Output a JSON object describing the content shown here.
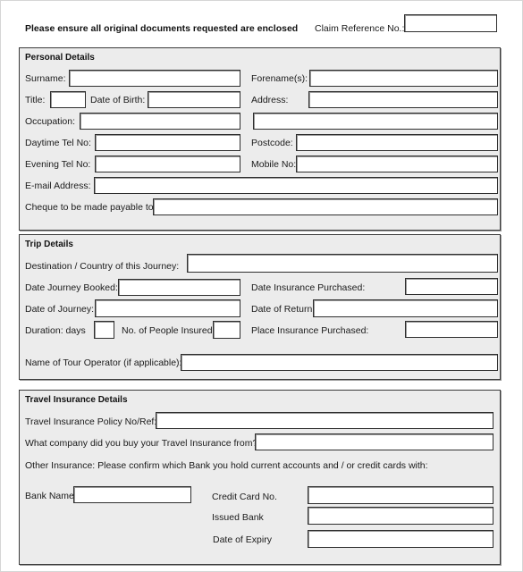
{
  "header": {
    "notice": "Please ensure all original documents requested are enclosed",
    "claim_ref_label": "Claim Reference No.:",
    "claim_ref_value": ""
  },
  "personal": {
    "title": "Personal Details",
    "fields": {
      "surname": {
        "label": "Surname:",
        "value": ""
      },
      "forenames": {
        "label": "Forename(s):",
        "value": ""
      },
      "title": {
        "label": "Title:",
        "value": ""
      },
      "dob": {
        "label": "Date of Birth:",
        "value": ""
      },
      "address": {
        "label": "Address:",
        "value": ""
      },
      "address2": {
        "value": ""
      },
      "occupation": {
        "label": "Occupation:",
        "value": ""
      },
      "day_tel": {
        "label": "Daytime Tel No:",
        "value": ""
      },
      "postcode": {
        "label": "Postcode:",
        "value": ""
      },
      "eve_tel": {
        "label": "Evening Tel No:",
        "value": ""
      },
      "mobile": {
        "label": "Mobile No:",
        "value": ""
      },
      "email": {
        "label": "E-mail Address:",
        "value": ""
      },
      "cheque": {
        "label": "Cheque to be made payable to:",
        "value": ""
      }
    }
  },
  "trip": {
    "title": "Trip Details",
    "fields": {
      "destination": {
        "label": "Destination / Country of this Journey:",
        "value": ""
      },
      "date_booked": {
        "label": "Date Journey Booked:",
        "value": ""
      },
      "date_ins_purchased": {
        "label": "Date Insurance Purchased:",
        "value": ""
      },
      "date_journey": {
        "label": "Date of Journey:",
        "value": ""
      },
      "date_return": {
        "label": "Date of Return:",
        "value": ""
      },
      "duration": {
        "label": "Duration:  days",
        "value": ""
      },
      "people": {
        "label": "No. of People Insured:",
        "value": ""
      },
      "place_ins": {
        "label": "Place Insurance Purchased:",
        "value": ""
      },
      "tour_operator": {
        "label": "Name of Tour Operator (if applicable):",
        "value": ""
      }
    }
  },
  "insurance": {
    "title": "Travel Insurance Details",
    "fields": {
      "policy": {
        "label": "Travel Insurance Policy No/Ref:",
        "value": ""
      },
      "company": {
        "label": "What company did you buy your Travel Insurance from?",
        "value": ""
      },
      "other_note": "Other Insurance: Please confirm which Bank you hold current accounts and / or credit cards with:",
      "bank_name": {
        "label": "Bank Name",
        "value": ""
      },
      "credit_card": {
        "label": "Credit Card No.",
        "value": ""
      },
      "issued_bank": {
        "label": "Issued Bank",
        "value": ""
      },
      "expiry": {
        "label": "Date of Expiry",
        "value": ""
      }
    }
  }
}
